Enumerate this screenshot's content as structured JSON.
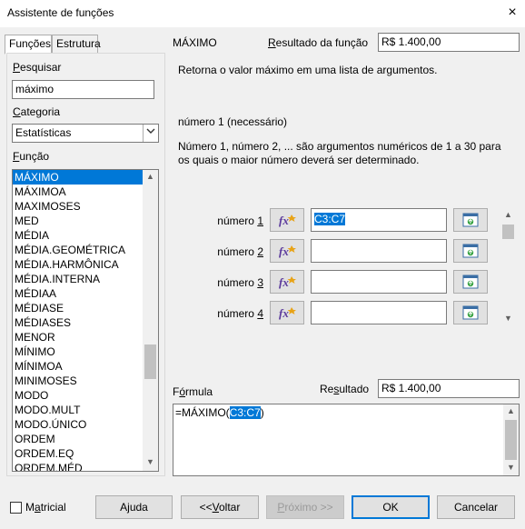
{
  "window": {
    "title": "Assistente de funções",
    "close_icon": "×"
  },
  "tabs": [
    {
      "label": "Funções"
    },
    {
      "label": "Estrutura"
    }
  ],
  "search": {
    "label": "Pesquisar",
    "value": "máximo"
  },
  "category": {
    "label": "Categoria",
    "selected": "Estatísticas"
  },
  "function_list": {
    "label": "Função",
    "items": [
      "MÁXIMO",
      "MÁXIMOA",
      "MAXIMOSES",
      "MED",
      "MÉDIA",
      "MÉDIA.GEOMÉTRICA",
      "MÉDIA.HARMÔNICA",
      "MÉDIA.INTERNA",
      "MÉDIAA",
      "MÉDIASE",
      "MÉDIASES",
      "MENOR",
      "MÍNIMO",
      "MÍNIMOA",
      "MINIMOSES",
      "MODO",
      "MODO.MULT",
      "MODO.ÚNICO",
      "ORDEM",
      "ORDEM.EQ",
      "ORDEM.MÉD"
    ]
  },
  "function": {
    "name": "MÁXIMO",
    "result_label": "Resultado da função",
    "result_value": "R$ 1.400,00",
    "description": "Retorna o valor máximo em uma lista de argumentos.",
    "arg_title": "número 1 (necessário)",
    "arg_description": "Número 1, número 2, ... são argumentos numéricos de 1 a 30 para os quais o maior número deverá ser determinado."
  },
  "arguments": [
    {
      "prefix": "número ",
      "num": "1",
      "value": "C3:C7"
    },
    {
      "prefix": "número ",
      "num": "2",
      "value": ""
    },
    {
      "prefix": "número ",
      "num": "3",
      "value": ""
    },
    {
      "prefix": "número ",
      "num": "4",
      "value": ""
    }
  ],
  "formula": {
    "label": "Fórmula",
    "result_label": "Resultado",
    "result_value": "R$ 1.400,00",
    "text_prefix": "=MÁXIMO(",
    "text_selected": "C3:C7",
    "text_suffix": ")"
  },
  "buttons": {
    "matricial": "Matricial",
    "help": "Ajuda",
    "back": "<<Voltar",
    "next": "Próximo >>",
    "ok": "OK",
    "cancel": "Cancelar"
  }
}
